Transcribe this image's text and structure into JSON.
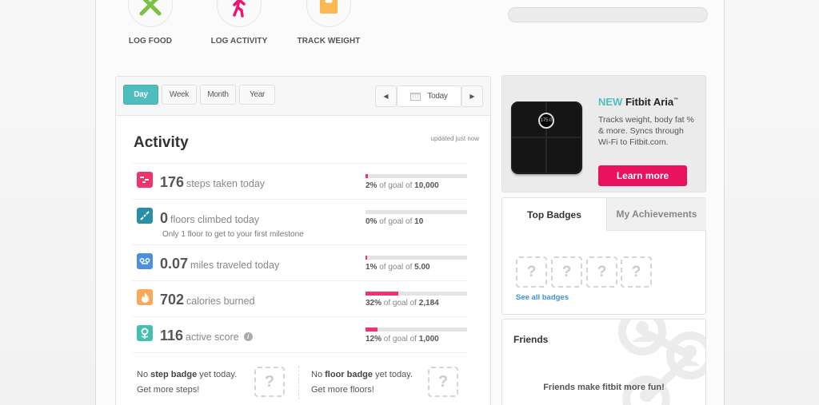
{
  "quick_actions": [
    {
      "label": "LOG FOOD",
      "icon": "fork-knife-icon",
      "color": "#79c142"
    },
    {
      "label": "LOG ACTIVITY",
      "icon": "walking-person-icon",
      "color": "#ec1671"
    },
    {
      "label": "TRACK WEIGHT",
      "icon": "scale-icon",
      "color": "#fdb850"
    }
  ],
  "range_tabs": [
    {
      "label": "Day",
      "active": true
    },
    {
      "label": "Week",
      "active": false
    },
    {
      "label": "Month",
      "active": false
    },
    {
      "label": "Year",
      "active": false
    }
  ],
  "date_nav": {
    "prev": "◀",
    "current": "Today",
    "next": "▶"
  },
  "activity": {
    "title": "Activity",
    "updated": "updated just now",
    "metrics": [
      {
        "value": "176",
        "desc": "steps taken today",
        "percent": 2,
        "percent_label": "2%",
        "goal_text": "of goal of",
        "goal": "10,000",
        "icon": "steps-icon",
        "icon_color": "#f0336b"
      },
      {
        "value": "0",
        "desc": "floors climbed today",
        "sub": "Only 1 floor to get to your first milestone",
        "percent": 0,
        "percent_label": "0%",
        "goal_text": "of goal of",
        "goal": "10",
        "icon": "stairs-icon",
        "icon_color": "#2a8fa6"
      },
      {
        "value": "0.07",
        "desc": "miles traveled today",
        "percent": 1,
        "percent_label": "1%",
        "goal_text": "of goal of",
        "goal": "5.00",
        "icon": "distance-icon",
        "icon_color": "#4a90e2"
      },
      {
        "value": "702",
        "desc": "calories burned",
        "percent": 32,
        "percent_label": "32%",
        "goal_text": "of goal of",
        "goal": "2,184",
        "icon": "flame-icon",
        "icon_color": "#fca75a"
      },
      {
        "value": "116",
        "desc": "active score",
        "percent": 12,
        "percent_label": "12%",
        "goal_text": "of goal of",
        "goal": "1,000",
        "icon": "flower-icon",
        "icon_color": "#42c0b0",
        "info": "i"
      }
    ],
    "step_badge": {
      "pre": "No ",
      "bold": "step badge",
      "post": " yet today.",
      "line2": "Get more steps!",
      "placeholder": "?"
    },
    "floor_badge": {
      "pre": "No ",
      "bold": "floor badge",
      "post": " yet today.",
      "line2": "Get more floors!",
      "placeholder": "?"
    }
  },
  "promo": {
    "new_label": "NEW",
    "product": "Fitbit Aria",
    "tm": "™",
    "description": "Tracks weight, body fat % & more. Syncs through Wi-Fi to Fitbit.com.",
    "scale_display": "175.0",
    "button": "Learn more"
  },
  "badges": {
    "tabs": [
      {
        "label": "Top Badges",
        "active": true
      },
      {
        "label": "My Achievements",
        "active": false
      }
    ],
    "placeholders": [
      "?",
      "?",
      "?",
      "?"
    ],
    "see_all": "See all badges"
  },
  "friends": {
    "title": "Friends",
    "message": "Friends make fitbit more fun!"
  },
  "colors": {
    "accent": "#4dbdbd",
    "progress": "#f0336b",
    "cta": "#e8125f",
    "link": "#3b8fe0"
  }
}
